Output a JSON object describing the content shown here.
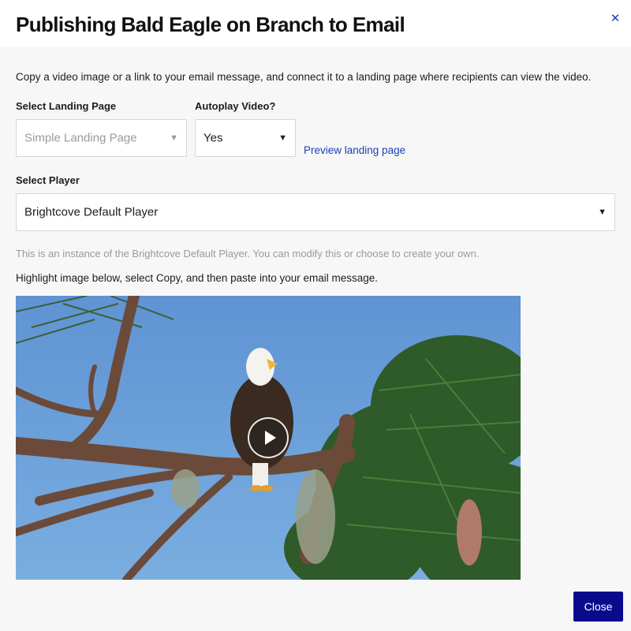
{
  "dialog": {
    "title": "Publishing Bald Eagle on Branch to Email",
    "close_icon": "close-icon",
    "intro": "Copy a video image or a link to your email message, and connect it to a landing page where recipients can view the video."
  },
  "landing_page": {
    "label": "Select Landing Page",
    "value": "Simple Landing Page"
  },
  "autoplay": {
    "label": "Autoplay Video?",
    "value": "Yes"
  },
  "preview_link": "Preview landing page",
  "player": {
    "label": "Select Player",
    "value": "Brightcove Default Player",
    "helper": "This is an instance of the Brightcove Default Player. You can modify this or choose to create your own."
  },
  "instructions": "Highlight image below, select Copy, and then paste into your email message.",
  "video": {
    "thumbnail_icon": "bald-eagle-thumbnail",
    "play_icon": "play-icon"
  },
  "footer": {
    "close_label": "Close"
  },
  "colors": {
    "accent": "#0a0a8c",
    "link": "#1a3fb3"
  }
}
